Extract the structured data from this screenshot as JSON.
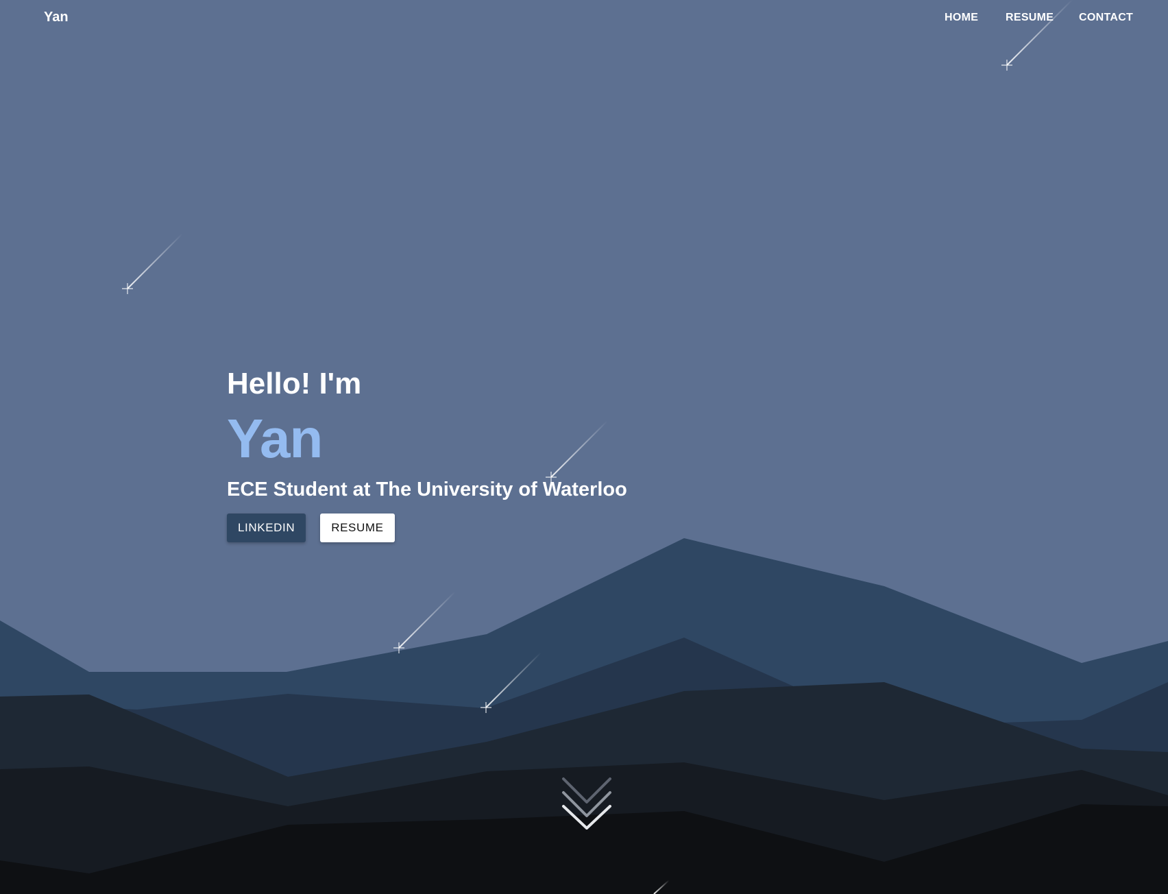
{
  "navbar": {
    "brand": "Yan",
    "links": [
      {
        "label": "HOME"
      },
      {
        "label": "RESUME"
      },
      {
        "label": "CONTACT"
      }
    ]
  },
  "hero": {
    "greeting": "Hello! I'm",
    "name": "Yan",
    "subtitle": "ECE Student at The University of Waterloo",
    "buttons": {
      "linkedin_label": "LINKEDIN",
      "resume_label": "RESUME"
    }
  },
  "colors": {
    "sky": "#5d7091",
    "accent_name": "#94bbf0",
    "button_primary": "#2f4763",
    "mountain_layers": [
      "#2f4763",
      "#25364d",
      "#1e2834",
      "#161b22",
      "#0e1013"
    ]
  },
  "icons": {
    "scroll_down": "chevron-down-icon",
    "shooting_star": "shooting-star-icon"
  }
}
